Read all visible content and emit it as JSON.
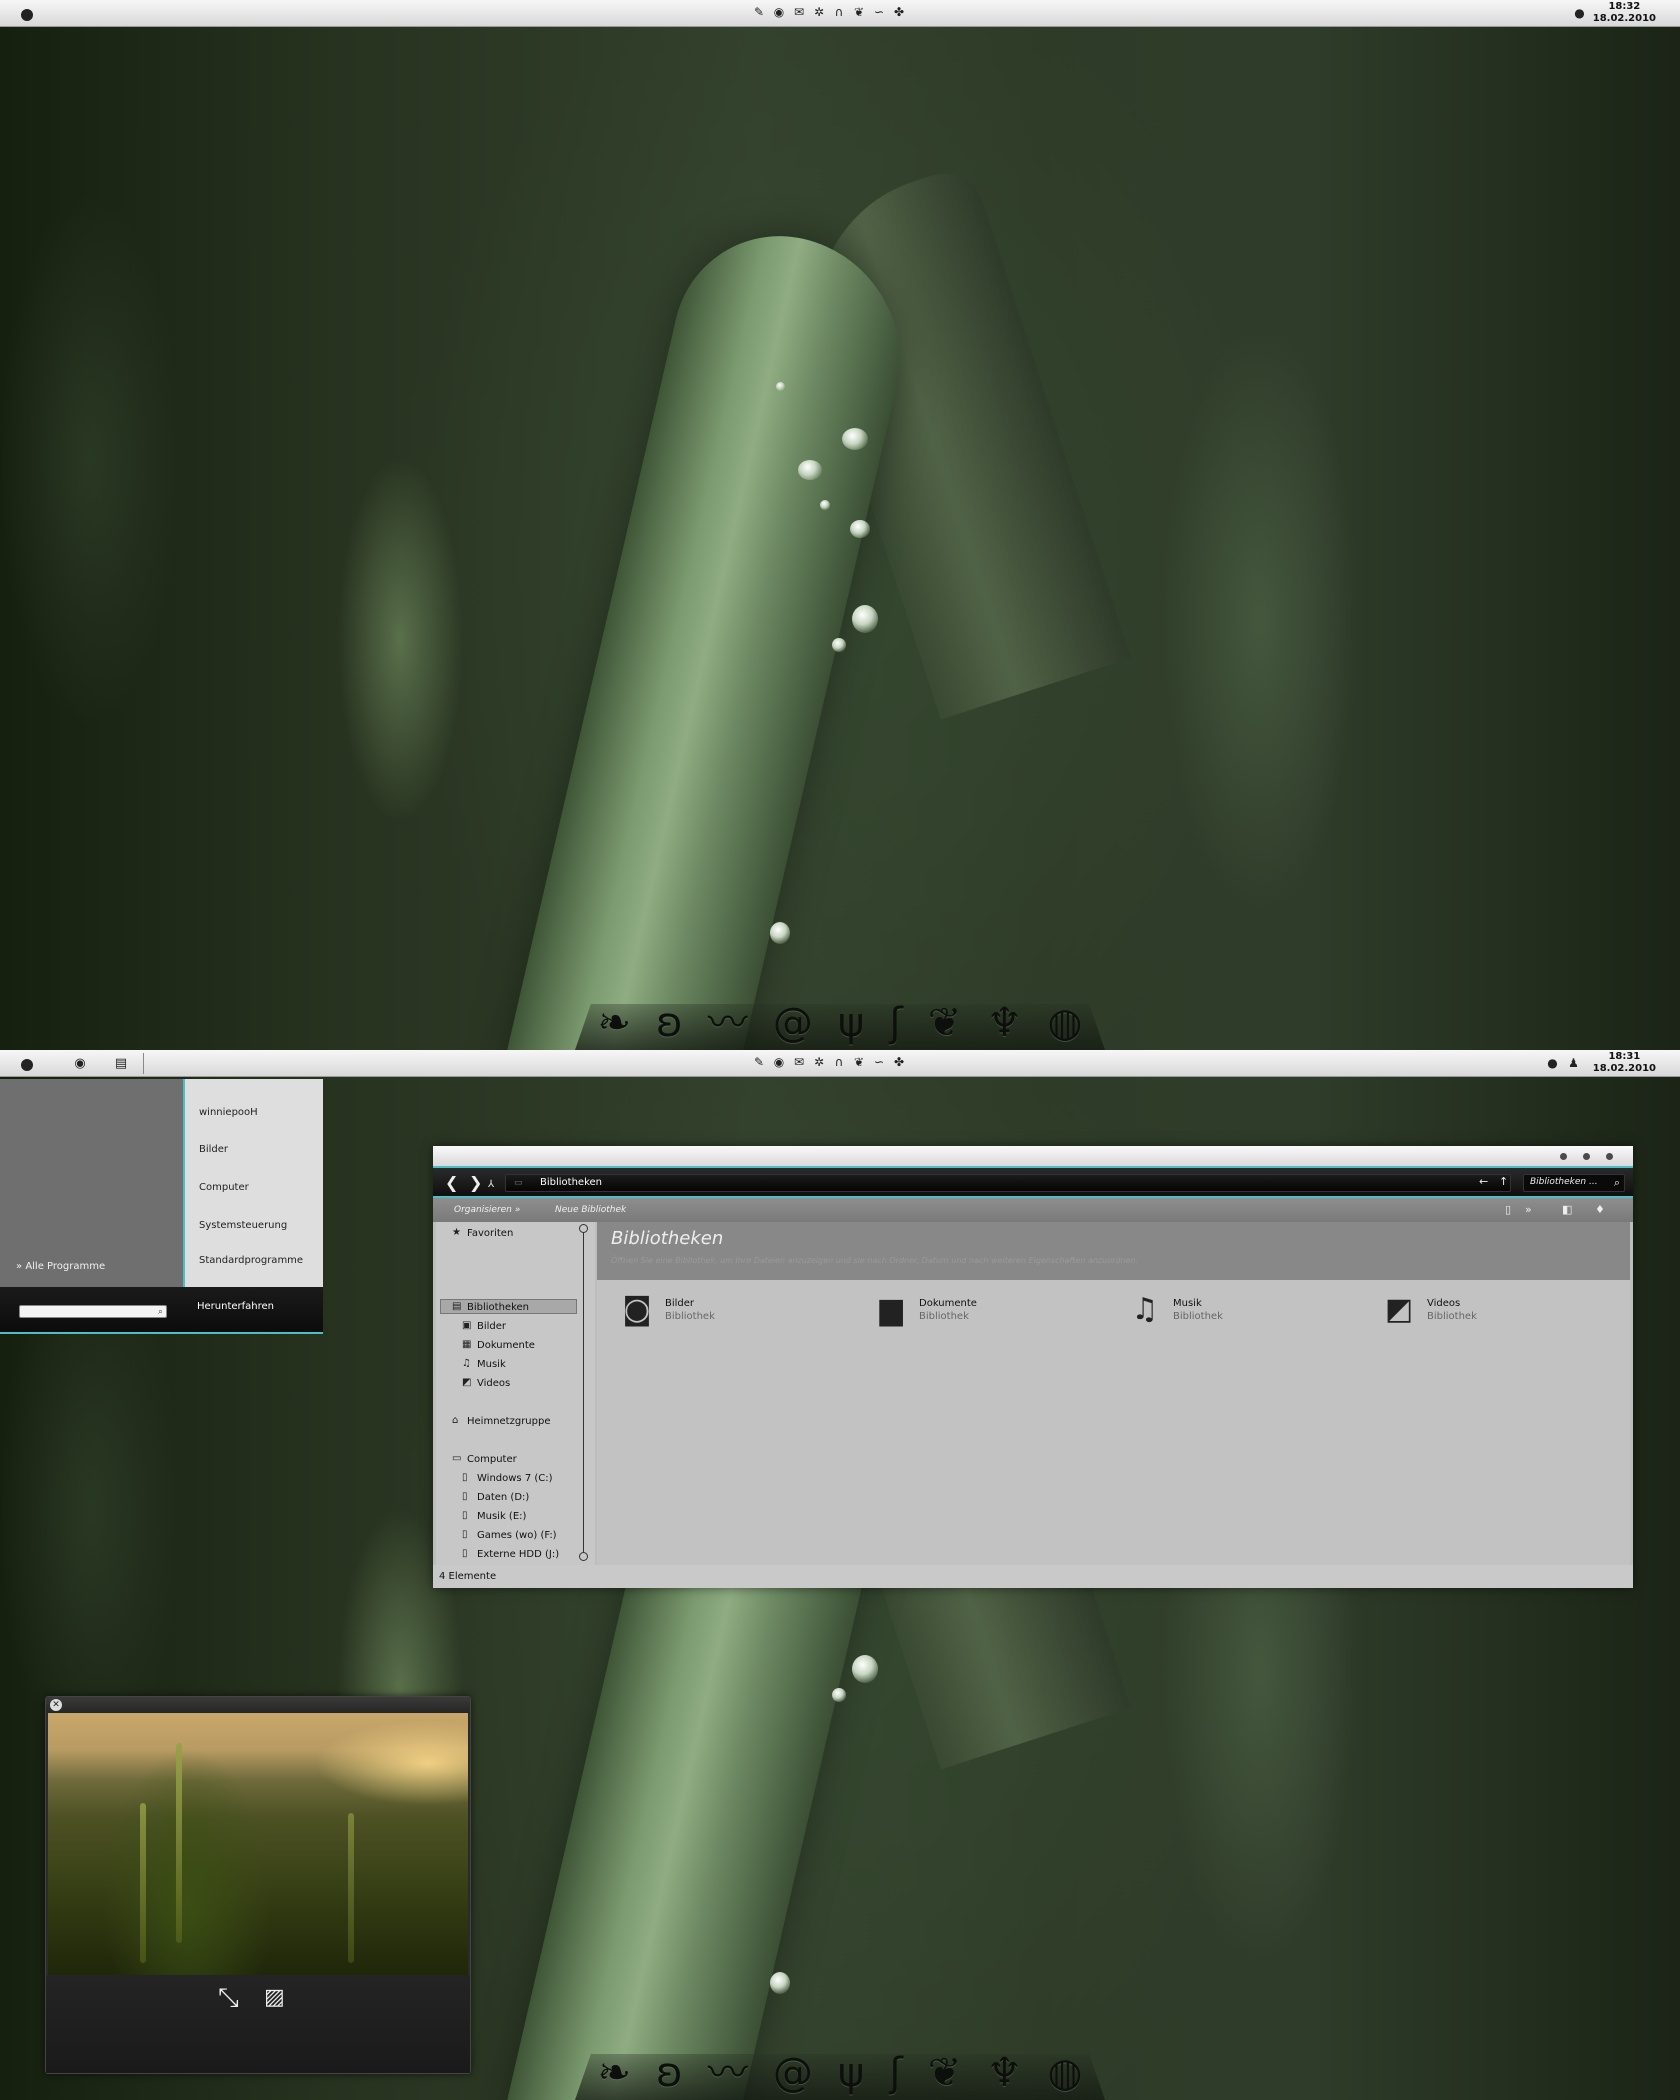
{
  "top": {
    "clock_time": "18:32",
    "clock_date": "18.02.2010",
    "tray_icons": [
      "pen-icon",
      "firefox-icon",
      "mail-icon",
      "settings-icon",
      "headphones-icon",
      "leaf-icon",
      "link-icon",
      "gamepad-icon"
    ]
  },
  "bottom": {
    "clock_time": "18:31",
    "clock_date": "18.02.2010",
    "start_menu": {
      "user": "winniepooH",
      "items": [
        "Bilder",
        "Computer",
        "Systemsteuerung",
        "Standardprogramme"
      ],
      "all_programs": "Alle Programme",
      "all_programs_glyph": "»",
      "shutdown": "Herunterfahren",
      "search_value": ""
    },
    "explorer": {
      "breadcrumb": "Bibliotheken",
      "search_placeholder": "Bibliotheken ...",
      "toolbar": {
        "organize": "Organisieren",
        "new_library": "Neue Bibliothek",
        "glyph": "»"
      },
      "nav": {
        "favorites": "Favoriten",
        "libraries": "Bibliotheken",
        "library_items": [
          "Bilder",
          "Dokumente",
          "Musik",
          "Videos"
        ],
        "homegroup": "Heimnetzgruppe",
        "computer": "Computer",
        "drives": [
          "Windows 7 (C:)",
          "Daten (D:)",
          "Musik (E:)",
          "Games (wo) (F:)",
          "Externe HDD (J:)"
        ]
      },
      "header_title": "Bibliotheken",
      "header_sub": "Öffnen Sie eine Bibliothek, um Ihre Dateien anzuzeigen und sie nach Ordner, Datum und nach weiteren Eigenschaften anzuordnen.",
      "libraries": [
        {
          "name": "Bilder",
          "type": "Bibliothek",
          "icon": "camera-icon"
        },
        {
          "name": "Dokumente",
          "type": "Bibliothek",
          "icon": "notebook-icon"
        },
        {
          "name": "Musik",
          "type": "Bibliothek",
          "icon": "music-note-icon"
        },
        {
          "name": "Videos",
          "type": "Bibliothek",
          "icon": "clapperboard-icon"
        }
      ],
      "status": "4 Elemente"
    }
  },
  "colors": {
    "accent": "#49c0c8",
    "explorer_bg": "#bdbdbd",
    "taskbar_top": "#f7f7f7"
  }
}
